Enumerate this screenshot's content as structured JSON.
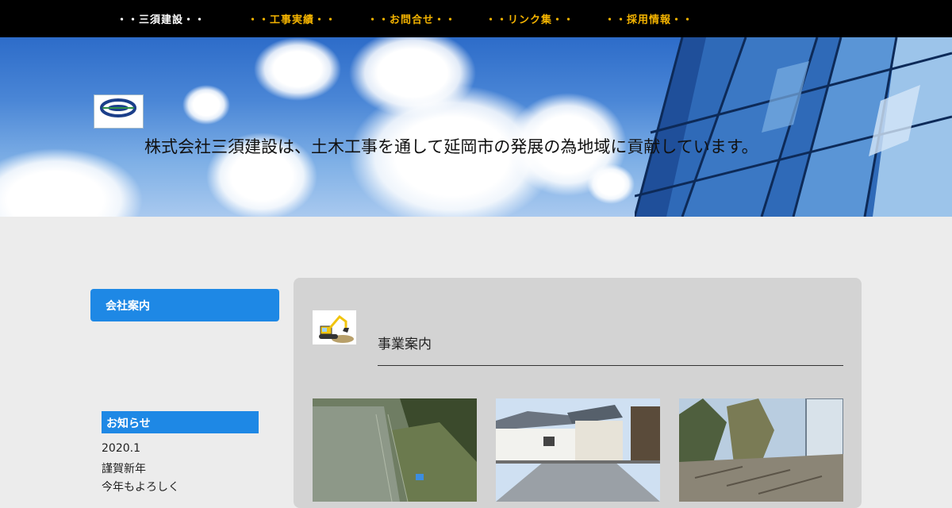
{
  "nav": {
    "items": [
      {
        "label": "・・三須建設・・"
      },
      {
        "label": "・・工事実績・・"
      },
      {
        "label": "・・お問合せ・・"
      },
      {
        "label": "・・リンク集・・"
      },
      {
        "label": "・・採用情報・・"
      }
    ]
  },
  "hero": {
    "logo_text": "misukensetu",
    "tagline": "株式会社三須建設は、土木工事を通して延岡市の発展の為地域に貢献しています。"
  },
  "sidebar": {
    "menu_button": "会社案内",
    "news": {
      "title": "お知らせ",
      "lines": [
        "2020.1",
        "謹賀新年",
        "今年もよろしく"
      ]
    }
  },
  "main": {
    "section_title": "事業案内",
    "photos": [
      "slope-work-photo",
      "house-street-photo",
      "demolition-photo"
    ]
  },
  "colors": {
    "nav_bg": "#000000",
    "nav_home": "#ffffff",
    "nav_accent": "#f5b400",
    "button_blue": "#1e88e5",
    "page_bg": "#ececec",
    "panel_bg": "#d3d3d3"
  }
}
